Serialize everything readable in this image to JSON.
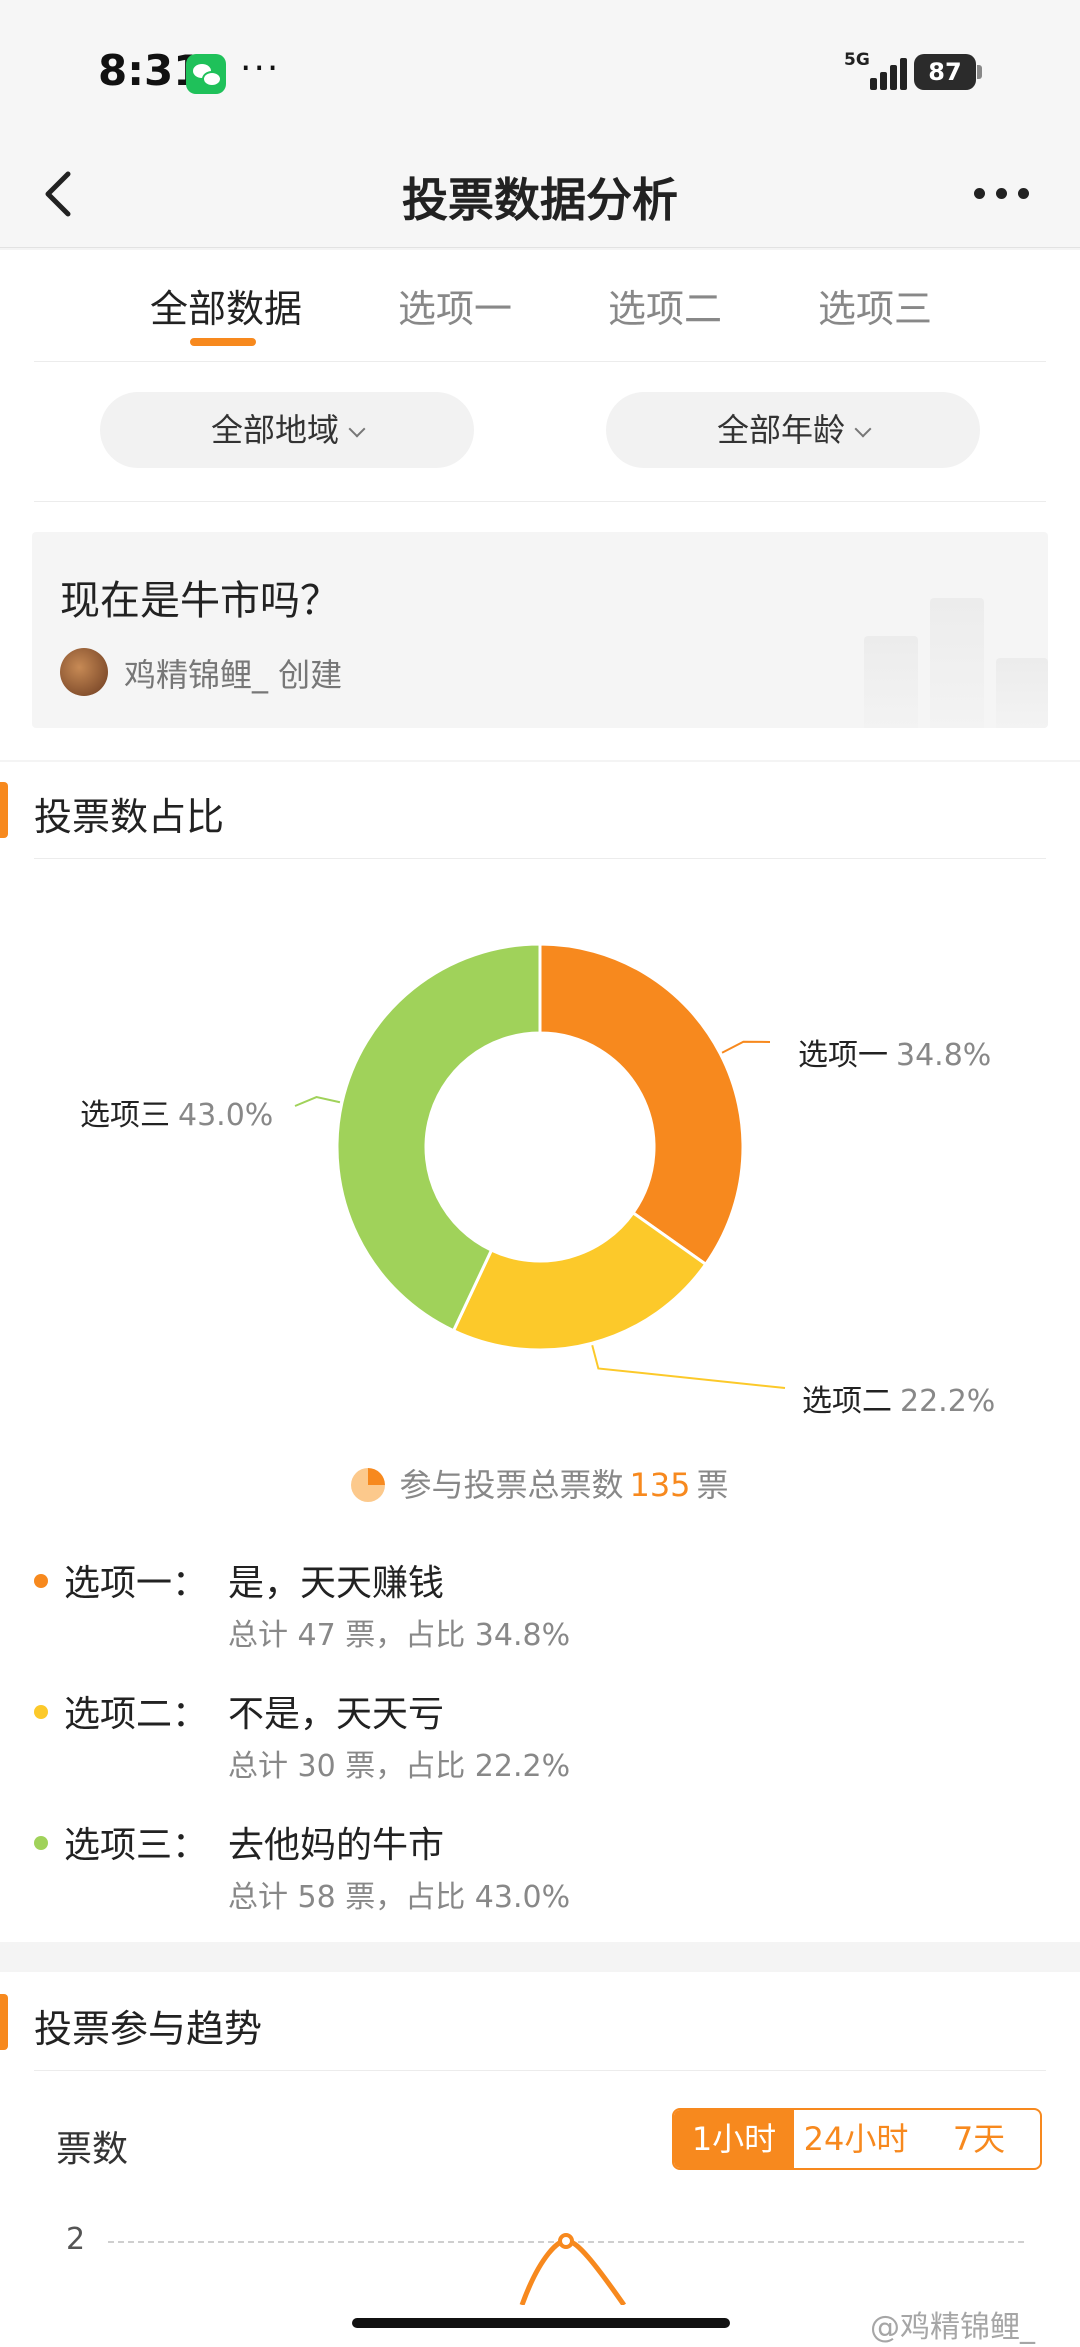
{
  "status_bar": {
    "time": "8:31",
    "more": "···",
    "network": "5G",
    "battery": "87"
  },
  "navbar": {
    "title": "投票数据分析"
  },
  "tabs": [
    {
      "label": "全部数据"
    },
    {
      "label": "选项一"
    },
    {
      "label": "选项二"
    },
    {
      "label": "选项三"
    }
  ],
  "filters": {
    "region": "全部地域",
    "age": "全部年龄"
  },
  "question": {
    "title": "现在是牛市吗？",
    "creator": "鸡精锦鲤_ 创建"
  },
  "share_section": {
    "title": "投票数占比"
  },
  "chart_data": {
    "type": "pie",
    "donut": true,
    "labels": [
      "选项一",
      "选项二",
      "选项三"
    ],
    "values": [
      34.8,
      22.2,
      43.0
    ],
    "value_labels": [
      "34.8%",
      "22.2%",
      "43.0%"
    ],
    "colors": [
      "#f7891e",
      "#fcc92a",
      "#a0d25a"
    ]
  },
  "total": {
    "prefix": "参与投票总票数",
    "count": "135",
    "unit": "票"
  },
  "options": [
    {
      "key": "选项一：",
      "text": "是，天天赚钱",
      "stat": "总计 47 票，占比 34.8%",
      "color": "#f7891e"
    },
    {
      "key": "选项二：",
      "text": "不是，天天亏",
      "stat": "总计 30 票，占比 22.2%",
      "color": "#fcc92a"
    },
    {
      "key": "选项三：",
      "text": "去他妈的牛市",
      "stat": "总计 58 票，占比 43.0%",
      "color": "#a0d25a"
    }
  ],
  "trend_section": {
    "title": "投票参与趋势",
    "ylabel": "票数",
    "ranges": [
      "1小时",
      "24小时",
      "7天"
    ],
    "selected_range": "1小时",
    "y_tick": "2"
  },
  "watermark": "@鸡精锦鲤_"
}
